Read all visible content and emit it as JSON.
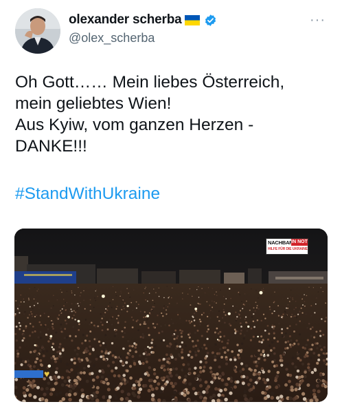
{
  "author": {
    "name": "olexander scherba",
    "handle": "@olex_scherba",
    "flag_icon": "ukraine-flag-icon",
    "verified_icon": "verified-badge-icon"
  },
  "more_icon": "more-options-icon",
  "more_label": "···",
  "tweet": {
    "text": "Oh Gott…… Mein liebes Österreich,\nmein geliebtes Wien!\nAus Kyiw, vom ganzen Herzen -\nDANKE!!!",
    "hashtag": "#StandWithUkraine"
  },
  "media": {
    "watermark_main": "NACHBAR",
    "watermark_red": "IN NOT",
    "watermark_sub": "HILFE FÜR DIE UKRAINE"
  },
  "colors": {
    "accent": "#1d9bf0",
    "verified": "#1d9bf0",
    "flag_blue": "#0057b7",
    "flag_yellow": "#ffd700"
  }
}
